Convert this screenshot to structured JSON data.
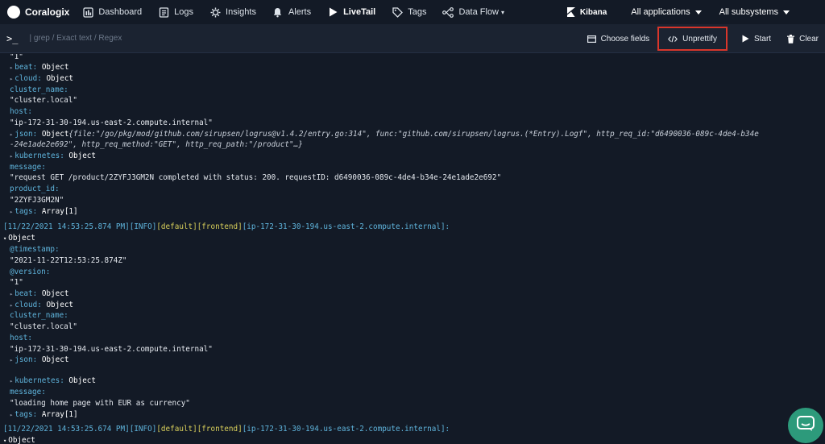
{
  "nav": {
    "brand": "Coralogix",
    "items": [
      {
        "label": "Dashboard",
        "icon": "dashboard-icon"
      },
      {
        "label": "Logs",
        "icon": "logs-icon"
      },
      {
        "label": "Insights",
        "icon": "insights-icon"
      },
      {
        "label": "Alerts",
        "icon": "bell-icon"
      },
      {
        "label": "LiveTail",
        "icon": "play-icon"
      },
      {
        "label": "Tags",
        "icon": "tag-icon"
      },
      {
        "label": "Data Flow",
        "icon": "dataflow-icon"
      }
    ],
    "kibana": "Kibana",
    "applications": "All applications",
    "subsystems": "All subsystems"
  },
  "toolbar": {
    "prompt": ">_",
    "search_placeholder": "| grep / Exact text / Regex",
    "choose_fields": "Choose fields",
    "unprettify": "Unprettify",
    "start": "Start",
    "clear": "Clear"
  },
  "log": {
    "l0": "\"1\"",
    "l1_key": "beat",
    "l1_val": "Object",
    "l2_key": "cloud",
    "l2_val": "Object",
    "l3_key": "cluster_name",
    "l4": "\"cluster.local\"",
    "l5_key": "host",
    "l6": "\"ip-172-31-30-194.us-east-2.compute.internal\"",
    "l7_key": "json",
    "l7_val": "Object",
    "l7_preview": "{file:\"/go/pkg/mod/github.com/sirupsen/logrus@v1.4.2/entry.go:314\", func:\"github.com/sirupsen/logrus.(*Entry).Logf\", http_req_id:\"d6490036-089c-4de4-b34e",
    "l8_preview": "-24e1ade2e692\", http_req_method:\"GET\", http_req_path:\"/product\"…}",
    "l9_key": "kubernetes",
    "l9_val": "Object",
    "l10_key": "message",
    "l11": "\"request GET /product/2ZYFJ3GM2N completed with status: 200. requestID: d6490036-089c-4de4-b34e-24e1ade2e692\"",
    "l12_key": "product_id",
    "l13": "\"2ZYFJ3GM2N\"",
    "l14_key": "tags",
    "l14_val": "Array[1]",
    "h1_ts": "[11/22/2021 14:53:25.874 PM]",
    "h1_lvl": "[INFO]",
    "h1_app": "[default]",
    "h1_sub": "[frontend]",
    "h1_host": "[ip-172-31-30-194.us-east-2.compute.internal]:",
    "obj1": "Object",
    "b_ts_key": "@timestamp",
    "b_ts_val": "\"2021-11-22T12:53:25.874Z\"",
    "b_ver_key": "@version",
    "b_ver_val": "\"1\"",
    "b_beat_key": "beat",
    "b_beat_val": "Object",
    "b_cloud_key": "cloud",
    "b_cloud_val": "Object",
    "b_cn_key": "cluster_name",
    "b_cn_val": "\"cluster.local\"",
    "b_host_key": "host",
    "b_host_val": "\"ip-172-31-30-194.us-east-2.compute.internal\"",
    "b_json_key": "json",
    "b_json_val": "Object",
    "b_k8s_key": "kubernetes",
    "b_k8s_val": "Object",
    "b_msg_key": "message",
    "b_msg_val": "\"loading home page with EUR as currency\"",
    "b_tags_key": "tags",
    "b_tags_val": "Array[1]",
    "h2_ts": "[11/22/2021 14:53:25.674 PM]",
    "h2_lvl": "[INFO]",
    "h2_app": "[default]",
    "h2_sub": "[frontend]",
    "h2_host": "[ip-172-31-30-194.us-east-2.compute.internal]:",
    "obj2": "Object"
  },
  "colors": {
    "background": "#131a26",
    "key": "#5fb4dc",
    "app_subsystem": "#d9d05b",
    "highlight_border": "#d9362b",
    "chat_bubble": "#2d9a7b"
  }
}
